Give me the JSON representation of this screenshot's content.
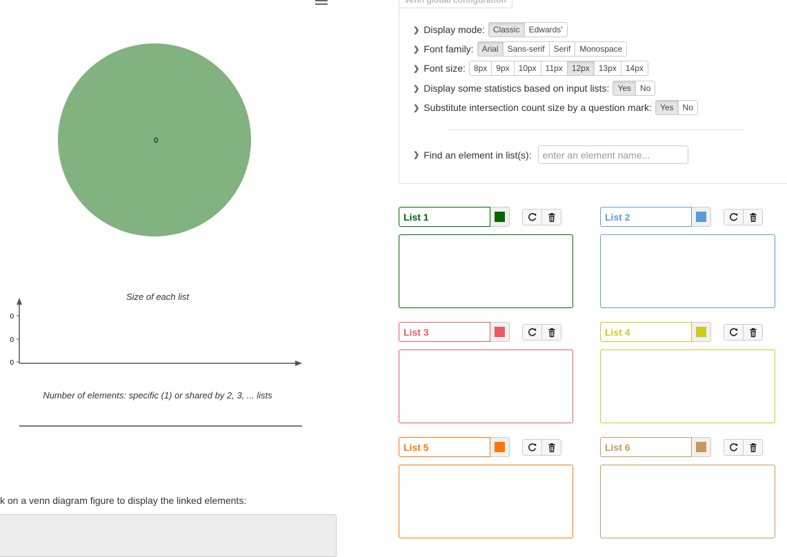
{
  "venn": {
    "circle_label": "0",
    "circle_color": "#81b27f"
  },
  "chart_data": {
    "type": "bar",
    "title": "Size of each list",
    "xlabel": "Number of elements: specific (1) or shared by 2, 3, ... lists",
    "ylabel": "",
    "y_tick_labels": [
      "0",
      "0",
      "0"
    ],
    "categories": [],
    "values": []
  },
  "click_message": "k on a venn diagram figure to display the linked elements:",
  "config": {
    "title": "venn global configuration",
    "display_mode": {
      "label": "Display mode:",
      "options": [
        "Classic",
        "Edwards'"
      ],
      "active": "Classic"
    },
    "font_family": {
      "label": "Font family:",
      "options": [
        "Arial",
        "Sans-serif",
        "Serif",
        "Monospace"
      ],
      "active": "Arial"
    },
    "font_size": {
      "label": "Font size:",
      "options": [
        "8px",
        "9px",
        "10px",
        "11px",
        "12px",
        "13px",
        "14px"
      ],
      "active": "12px"
    },
    "stats": {
      "label": "Display some statistics based on input lists:",
      "options": [
        "Yes",
        "No"
      ],
      "active": "Yes"
    },
    "question_mark": {
      "label": "Substitute intersection count size by a question mark:",
      "options": [
        "Yes",
        "No"
      ],
      "active": "Yes"
    },
    "find": {
      "label": "Find an element in list(s):",
      "placeholder": "enter an element name..."
    }
  },
  "lists": [
    {
      "name": "List 1",
      "color": "#006600"
    },
    {
      "name": "List 2",
      "color": "#5b9bd5"
    },
    {
      "name": "List 3",
      "color": "#eb5a5e"
    },
    {
      "name": "List 4",
      "color": "#cccc1e"
    },
    {
      "name": "List 5",
      "color": "#ff7700"
    },
    {
      "name": "List 6",
      "color": "#c49a5a"
    }
  ],
  "icons": {
    "refresh": "refresh-icon",
    "trash": "trash-icon",
    "menu": "hamburger-menu-icon",
    "chevron": "chevron-right-icon"
  }
}
